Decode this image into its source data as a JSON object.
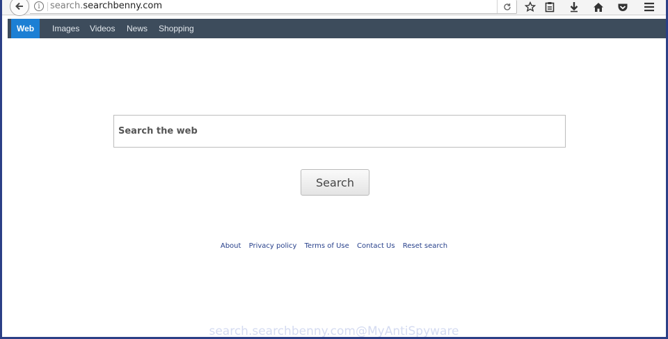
{
  "browser": {
    "url_prefix": "search.",
    "url_domain": "searchbenny.com",
    "icons": {
      "back": "back-arrow-icon",
      "info": "info-icon",
      "reload": "reload-icon",
      "bookmark": "star-icon",
      "reading_list": "clipboard-icon",
      "download": "download-icon",
      "home": "home-icon",
      "pocket": "pocket-icon",
      "menu": "hamburger-menu-icon"
    }
  },
  "nav": {
    "items": [
      {
        "label": "Web",
        "active": true
      },
      {
        "label": "Images",
        "active": false
      },
      {
        "label": "Videos",
        "active": false
      },
      {
        "label": "News",
        "active": false
      },
      {
        "label": "Shopping",
        "active": false
      }
    ],
    "active_color": "#1c7fd4",
    "bar_color": "#3d4c5c"
  },
  "search": {
    "placeholder": "Search the web",
    "value": "",
    "button_label": "Search"
  },
  "footer": {
    "links": [
      "About",
      "Privacy policy",
      "Terms of Use",
      "Contact Us",
      "Reset search"
    ]
  },
  "watermark": "search.searchbenny.com@MyAntiSpyware"
}
